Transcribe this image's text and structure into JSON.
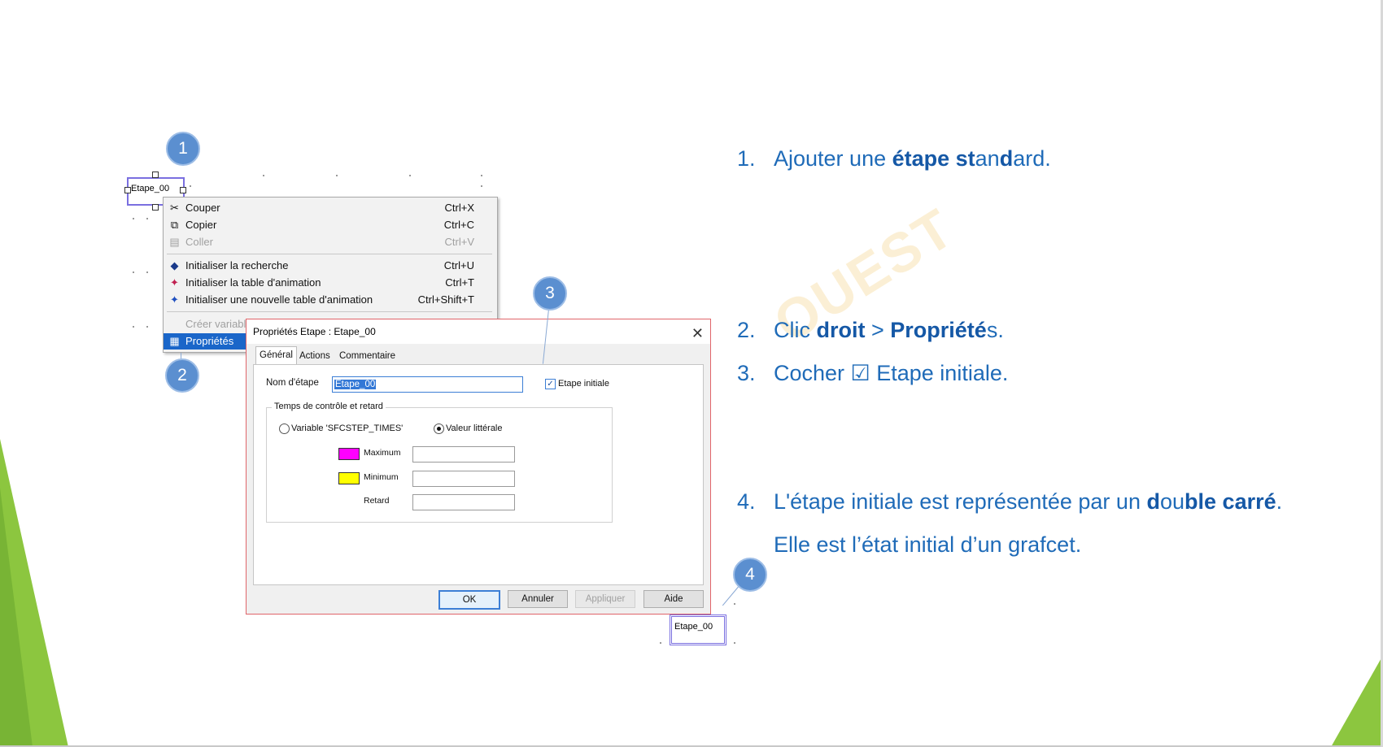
{
  "step_box": {
    "label": "Etape_00"
  },
  "context_menu": {
    "items": [
      {
        "label": "Couper",
        "shortcut": "Ctrl+X",
        "icon": "scissors-icon",
        "disabled": false
      },
      {
        "label": "Copier",
        "shortcut": "Ctrl+C",
        "icon": "copy-icon",
        "disabled": false
      },
      {
        "label": "Coller",
        "shortcut": "Ctrl+V",
        "icon": "paste-icon",
        "disabled": true
      },
      {
        "label": "Initialiser la recherche",
        "shortcut": "Ctrl+U",
        "icon": "search-init-icon",
        "disabled": false
      },
      {
        "label": "Initialiser la table d'animation",
        "shortcut": "Ctrl+T",
        "icon": "animation-table-icon",
        "disabled": false
      },
      {
        "label": "Initialiser une nouvelle table d'animation",
        "shortcut": "Ctrl+Shift+T",
        "icon": "new-animation-table-icon",
        "disabled": false
      },
      {
        "label": "Créer variabl",
        "shortcut": "",
        "icon": "",
        "disabled": true
      },
      {
        "label": "Propriétés",
        "shortcut": "",
        "icon": "properties-icon",
        "disabled": false,
        "selected": true
      }
    ]
  },
  "dialog": {
    "title": "Propriétés Etape : Etape_00",
    "close": "✕",
    "tabs": [
      "Général",
      "Actions",
      "Commentaire"
    ],
    "active_tab": "Général",
    "step_name_label": "Nom d'étape",
    "step_name_value": "Etape_00",
    "initial_step_label": "Etape initiale",
    "initial_step_checked": true,
    "group_label": "Temps de contrôle et retard",
    "radio_variable": "Variable 'SFCSTEP_TIMES'",
    "radio_literal": "Valeur littérale",
    "selected_radio": "Valeur littérale",
    "maximum_label": "Maximum",
    "minimum_label": "Minimum",
    "delay_label": "Retard",
    "maximum_color": "#ff00ff",
    "minimum_color": "#ffff00",
    "buttons": {
      "ok": "OK",
      "cancel": "Annuler",
      "apply": "Appliquer",
      "help": "Aide"
    }
  },
  "callouts": [
    "1",
    "2",
    "3",
    "4"
  ],
  "instructions": [
    {
      "number": "1.",
      "parts": [
        [
          "Ajouter une ",
          false
        ],
        [
          "étape st",
          true
        ],
        [
          "an",
          false
        ],
        [
          "d",
          true
        ],
        [
          "ard.",
          false
        ]
      ]
    },
    {
      "number": "2.",
      "parts": [
        [
          "Clic ",
          false
        ],
        [
          "droit",
          true
        ],
        [
          " > ",
          false
        ],
        [
          "Propriété",
          true
        ],
        [
          "s.",
          false
        ]
      ]
    },
    {
      "number": "3.",
      "parts": [
        [
          "Cocher ☑ Etape initiale.",
          false
        ]
      ]
    },
    {
      "number": "4.",
      "parts": [
        [
          "L'étape initiale est représentée par un ",
          false
        ],
        [
          "d",
          true
        ],
        [
          "ou",
          false
        ],
        [
          "ble",
          true
        ],
        [
          " ",
          false
        ],
        [
          "carré",
          true
        ],
        [
          ".",
          false
        ]
      ]
    },
    {
      "number": "",
      "parts": [
        [
          "Elle est l’état initial d’un grafcet.",
          false
        ]
      ]
    }
  ],
  "watermark": "OUEST",
  "colors": {
    "accent_text": "#1f6bb8",
    "callout": "#5b8fd0",
    "green": "#8cc63f",
    "step_border": "#7a6fe0"
  }
}
